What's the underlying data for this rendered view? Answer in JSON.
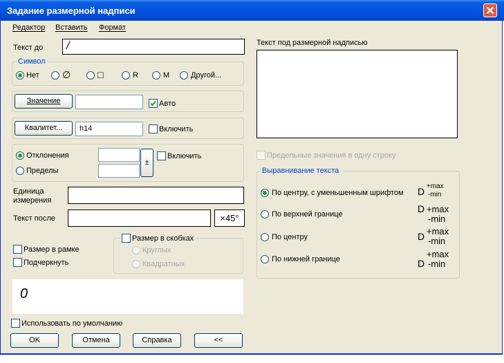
{
  "window": {
    "title": "Задание размерной надписи"
  },
  "menu": [
    "Редактор",
    "Вставить",
    "Формат"
  ],
  "text_before": {
    "label": "Текст до",
    "value": "/"
  },
  "symbol": {
    "legend": "Символ",
    "options": [
      {
        "label": "Нет",
        "checked": true
      },
      {
        "label": "∅",
        "checked": false
      },
      {
        "label": "□",
        "checked": false
      },
      {
        "label": "R",
        "checked": false
      },
      {
        "label": "M",
        "checked": false
      },
      {
        "label": "Другой...",
        "checked": false
      }
    ]
  },
  "value_row": {
    "button": "Значение",
    "field": "",
    "auto_label": "Авто",
    "auto_checked": true
  },
  "qualitet_row": {
    "button": "Квалитет...",
    "field": "h14",
    "include_label": "Включить",
    "include_checked": false
  },
  "deviation_row": {
    "deviations_label": "Отклонения",
    "limits_label": "Пределы",
    "plusminus": "±",
    "include_label": "Включить",
    "selected": "deviations"
  },
  "units": {
    "label_line1": "Единица",
    "label_line2": "измерения",
    "value": ""
  },
  "text_after": {
    "label": "Текст после",
    "value": "",
    "button": "×45°"
  },
  "options": {
    "frame_label": "Размер в рамке",
    "underline_label": "Подчеркнуть"
  },
  "brackets": {
    "label": "Размер в скобках",
    "round": "Круглых",
    "square": "Квадратных"
  },
  "preview": {
    "text": "0"
  },
  "use_default": {
    "label": "Использовать по умолчанию"
  },
  "buttons": {
    "ok": "OK",
    "cancel": "Отмена",
    "help": "Справка",
    "collapse": "<<"
  },
  "text_under": {
    "label": "Текст под размерной надписью",
    "value": ""
  },
  "single_line": {
    "label": "Предельные значения в одну строку"
  },
  "alignment": {
    "legend": "Выравнивание текста",
    "items": [
      {
        "label": "По центру, с уменьшенным шрифтом",
        "checked": true
      },
      {
        "label": "По верхней границе",
        "checked": false
      },
      {
        "label": "По центру",
        "checked": false
      },
      {
        "label": "По нижней границе",
        "checked": false
      }
    ],
    "sample": {
      "d": "D",
      "max": "+max",
      "min": "-min"
    }
  },
  "colors": {
    "title_bar": "#0454e0",
    "dialog_bg": "#ece9d8",
    "legend": "#0046d5",
    "radio_dot": "#21a121"
  }
}
